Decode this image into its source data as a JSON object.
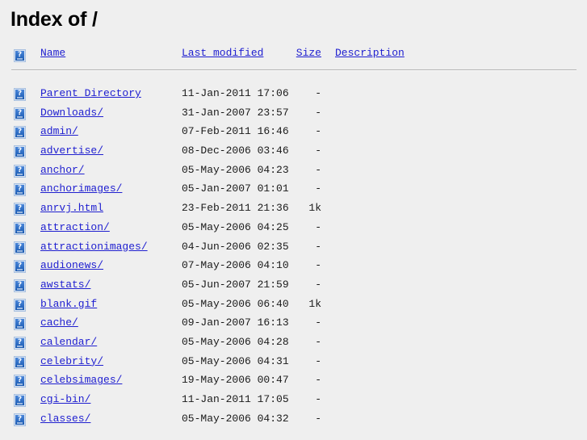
{
  "page": {
    "title": "Index of /"
  },
  "icons": {
    "broken_image": "broken-image-icon"
  },
  "columns": {
    "name": "Name",
    "last_modified": "Last modified",
    "size": "Size",
    "description": "Description"
  },
  "entries": [
    {
      "name": "Parent Directory",
      "last_modified": "11-Jan-2011 17:06",
      "size": "-",
      "description": ""
    },
    {
      "name": "Downloads/",
      "last_modified": "31-Jan-2007 23:57",
      "size": "-",
      "description": ""
    },
    {
      "name": "admin/",
      "last_modified": "07-Feb-2011 16:46",
      "size": "-",
      "description": ""
    },
    {
      "name": "advertise/",
      "last_modified": "08-Dec-2006 03:46",
      "size": "-",
      "description": ""
    },
    {
      "name": "anchor/",
      "last_modified": "05-May-2006 04:23",
      "size": "-",
      "description": ""
    },
    {
      "name": "anchorimages/",
      "last_modified": "05-Jan-2007 01:01",
      "size": "-",
      "description": ""
    },
    {
      "name": "anrvj.html",
      "last_modified": "23-Feb-2011 21:36",
      "size": "1k",
      "description": ""
    },
    {
      "name": "attraction/",
      "last_modified": "05-May-2006 04:25",
      "size": "-",
      "description": ""
    },
    {
      "name": "attractionimages/",
      "last_modified": "04-Jun-2006 02:35",
      "size": "-",
      "description": ""
    },
    {
      "name": "audionews/",
      "last_modified": "07-May-2006 04:10",
      "size": "-",
      "description": ""
    },
    {
      "name": "awstats/",
      "last_modified": "05-Jun-2007 21:59",
      "size": "-",
      "description": ""
    },
    {
      "name": "blank.gif",
      "last_modified": "05-May-2006 06:40",
      "size": "1k",
      "description": ""
    },
    {
      "name": "cache/",
      "last_modified": "09-Jan-2007 16:13",
      "size": "-",
      "description": ""
    },
    {
      "name": "calendar/",
      "last_modified": "05-May-2006 04:28",
      "size": "-",
      "description": ""
    },
    {
      "name": "celebrity/",
      "last_modified": "05-May-2006 04:31",
      "size": "-",
      "description": ""
    },
    {
      "name": "celebsimages/",
      "last_modified": "19-May-2006 00:47",
      "size": "-",
      "description": ""
    },
    {
      "name": "cgi-bin/",
      "last_modified": "11-Jan-2011 17:05",
      "size": "-",
      "description": ""
    },
    {
      "name": "classes/",
      "last_modified": "05-May-2006 04:32",
      "size": "-",
      "description": ""
    }
  ],
  "colors": {
    "background": "#efefef",
    "link": "#2020d0",
    "text": "#000000",
    "rule": "#b5b5b5",
    "icon_blue": "#2f6ec4"
  }
}
